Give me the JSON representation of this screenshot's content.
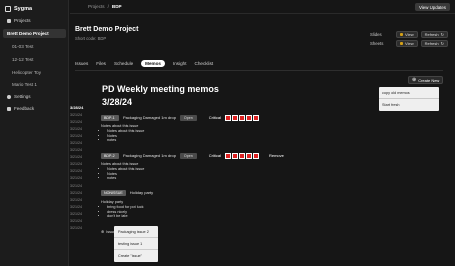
{
  "app": {
    "name": "Sygma"
  },
  "sidebar": {
    "items": [
      {
        "label": "Projects",
        "icon": "folder-icon",
        "active": false
      },
      {
        "label": "Brett Demo Project",
        "icon": "",
        "active": true
      },
      {
        "label": "01-03 Test"
      },
      {
        "label": "12-12 Test"
      },
      {
        "label": "Helicopter Toy"
      },
      {
        "label": "Mario Test 1"
      },
      {
        "label": "Settings",
        "icon": "gear-icon"
      },
      {
        "label": "Feedback",
        "icon": "feedback-icon"
      }
    ]
  },
  "topbar": {
    "breadcrumb": [
      "Projects",
      "/",
      "BDP"
    ],
    "view_updates": "View Updates"
  },
  "project": {
    "title": "Brett Demo Project",
    "short_code": "Short code: BDP",
    "links": [
      {
        "label": "Slides",
        "view": "View",
        "refresh": "Refresh"
      },
      {
        "label": "Sheets",
        "view": "View",
        "refresh": "Refresh"
      }
    ]
  },
  "tabs": [
    "Issues",
    "Files",
    "Schedule",
    "Memos",
    "Insight",
    "Checklist"
  ],
  "active_tab": "Memos",
  "create_new": {
    "label": "Create New",
    "options": [
      "copy old memos",
      "Start fresh"
    ]
  },
  "memo": {
    "title": "PD Weekly meeting memos",
    "date": "3/28/24",
    "dates": [
      "3/28/24",
      "3/21/24",
      "3/21/24",
      "3/21/24",
      "3/21/24",
      "3/21/24",
      "3/21/24",
      "3/21/24",
      "3/21/24",
      "3/21/24",
      "3/21/24",
      "3/21/24",
      "3/21/24",
      "3/21/24",
      "3/21/24",
      "3/21/24",
      "3/21/24",
      "3/21/24"
    ],
    "issues": [
      {
        "code": "BDP-1",
        "title": "Packaging Damaged 1m drop",
        "status": "Open",
        "severity": "Critical",
        "remove": ""
      },
      {
        "code": "BDP-2",
        "title": "Packaging Damaged 1m drop",
        "status": "Open",
        "severity": "Critical",
        "remove": "Remove"
      }
    ],
    "notes_1": {
      "head": "Notes about this issue",
      "items": [
        "Notes about this issue",
        "Notes",
        "notes"
      ]
    },
    "notes_2": {
      "head": "Notes about this issue",
      "items": [
        "Notes about this issue",
        "Notes",
        "notes"
      ]
    },
    "nonissue": {
      "code": "NONISSUE",
      "title": "Holiday party"
    },
    "notes_3": {
      "head": "Holiday party",
      "items": [
        "bring food for pot luck",
        "dress nicely",
        "don't be late"
      ]
    },
    "issue_trigger": "Issue",
    "issue_dropdown": [
      "Packaging issue 2",
      "testing issue 1",
      "Create \"issue\""
    ]
  },
  "colors": {
    "critical": "#dd2222",
    "accent": "#d4a017"
  }
}
